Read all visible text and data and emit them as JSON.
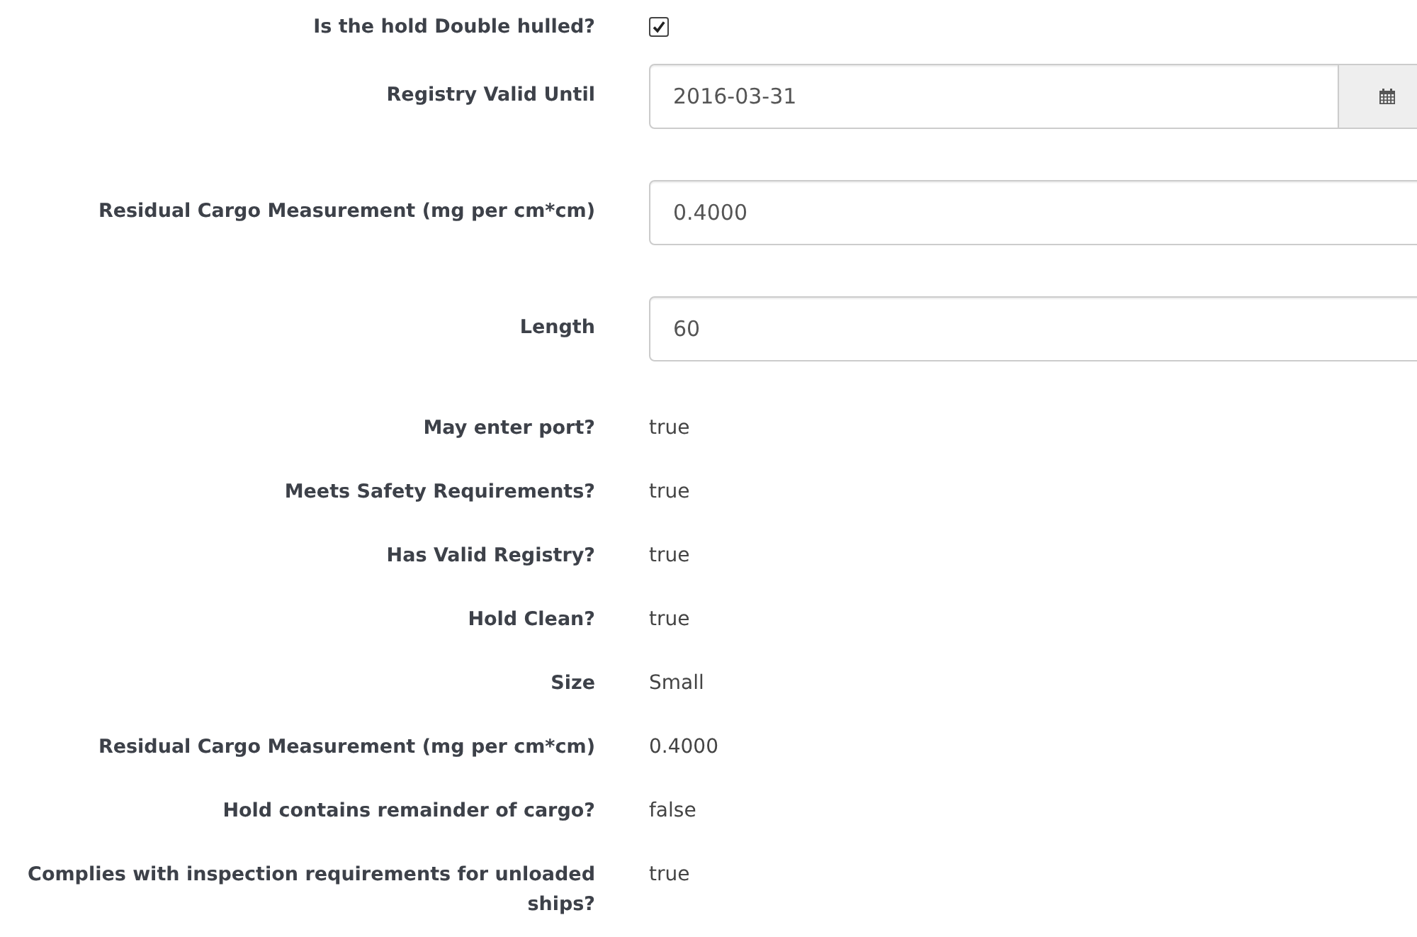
{
  "fields": [
    {
      "kind": "checkbox",
      "label": "Is the hold Double hulled?",
      "checked": true
    },
    {
      "kind": "date",
      "label": "Registry Valid Until",
      "value": "2016-03-31"
    },
    {
      "kind": "text",
      "label": "Residual Cargo Measurement (mg per cm*cm)",
      "value": "0.4000"
    },
    {
      "kind": "text",
      "label": "Length",
      "value": "60"
    },
    {
      "kind": "static",
      "label": "May enter port?",
      "value": "true"
    },
    {
      "kind": "static",
      "label": "Meets Safety Requirements?",
      "value": "true"
    },
    {
      "kind": "static",
      "label": "Has Valid Registry?",
      "value": "true"
    },
    {
      "kind": "static",
      "label": "Hold Clean?",
      "value": "true"
    },
    {
      "kind": "static",
      "label": "Size",
      "value": "Small"
    },
    {
      "kind": "static",
      "label": "Residual Cargo Measurement (mg per cm*cm)",
      "value": "0.4000"
    },
    {
      "kind": "static",
      "label": "Hold contains remainder of cargo?",
      "value": "false"
    },
    {
      "kind": "static",
      "label": "Complies with inspection requirements for unloaded ships?",
      "value": "true"
    }
  ]
}
